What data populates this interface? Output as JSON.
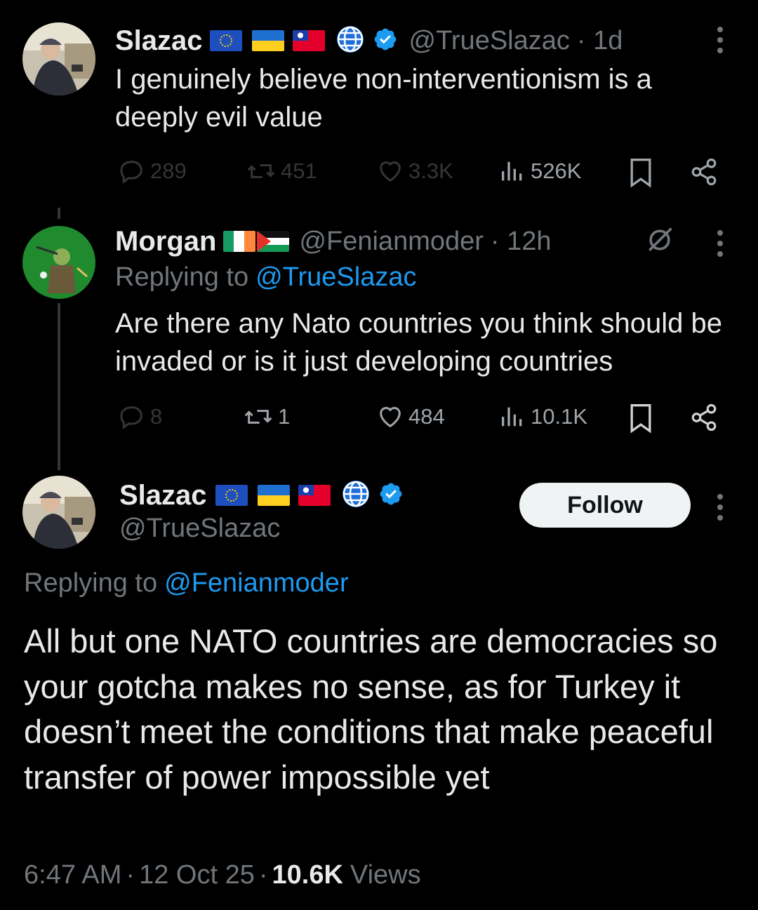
{
  "tweet1": {
    "name": "Slazac",
    "handle": "@TrueSlazac",
    "time": "· 1d",
    "text": "I genuinely believe non-interventionism is a deeply evil value",
    "replies": "289",
    "retweets": "451",
    "likes": "3.3K",
    "views": "526K",
    "flags": [
      "eu-flag-icon",
      "ukraine-flag-icon",
      "taiwan-flag-icon",
      "globe-icon"
    ]
  },
  "tweet2": {
    "name": "Morgan",
    "handle": "@Fenianmoder",
    "time": "· 12h",
    "replying_prefix": "Replying to",
    "replying_to": "@TrueSlazac",
    "text": "Are there any Nato countries you think should be invaded or is it just developing countries",
    "replies": "8",
    "retweets": "1",
    "likes": "484",
    "views": "10.1K",
    "flags": [
      "ireland-flag-icon",
      "palestine-flag-icon"
    ]
  },
  "tweet3": {
    "name": "Slazac",
    "handle": "@TrueSlazac",
    "follow_label": "Follow",
    "replying_prefix": "Replying to",
    "replying_to": "@Fenianmoder",
    "text": "All but one NATO countries are democracies so your gotcha makes no sense, as for Turkey it doesn’t meet the conditions that make peaceful transfer of power impossible yet",
    "time": "6:47 AM",
    "date": "12 Oct 25",
    "views_count": "10.6K",
    "views_label": "Views"
  },
  "colors": {
    "background": "#000000",
    "text": "#e7e9ea",
    "muted": "#71767b",
    "link": "#1d9bf0",
    "verified": "#1d9bf0"
  }
}
